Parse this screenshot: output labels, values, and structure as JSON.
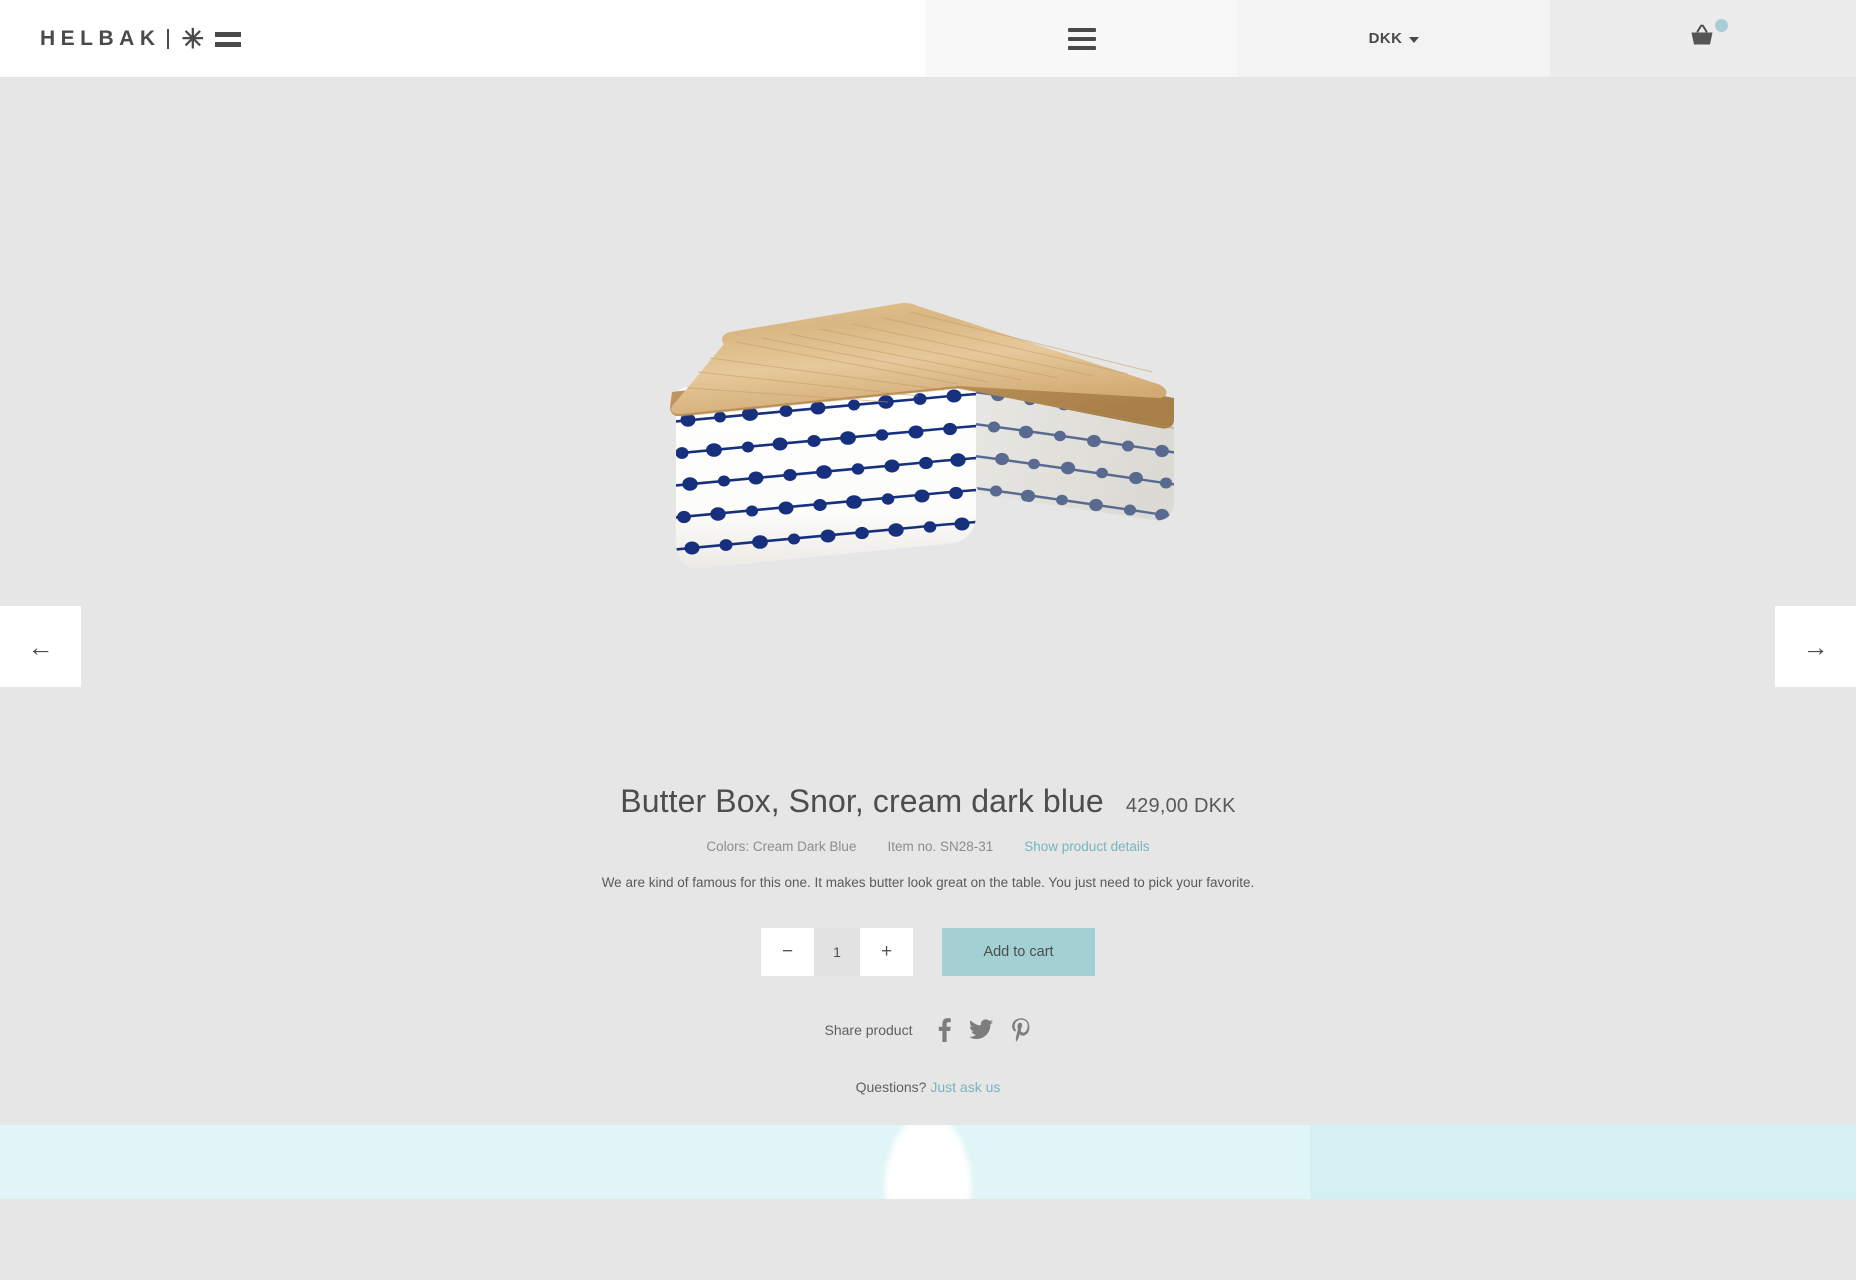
{
  "header": {
    "logo": {
      "word": "HELBAK",
      "asterisk": "✳",
      "divider_icon": "vertical-bar-icon",
      "equals_icon": "double-line-icon"
    },
    "menu_icon": "hamburger-menu-icon",
    "currency": {
      "selected": "DKK",
      "caret_icon": "chevron-down-icon"
    },
    "cart": {
      "icon": "shopping-basket-icon",
      "badge_color": "#a8cdd6"
    }
  },
  "gallery": {
    "prev_label": "←",
    "next_label": "→",
    "prev_icon": "arrow-left-icon",
    "next_icon": "arrow-right-icon",
    "product_image_alt": "Butter Box, Snor, cream dark blue - white ceramic box with navy blue beaded string pattern and oak wood lid"
  },
  "product": {
    "title": "Butter Box, Snor, cream dark blue",
    "price": "429,00 DKK",
    "colors": "Colors: Cream Dark Blue",
    "item_no": "Item no. SN28-31",
    "details_link": "Show product details",
    "description": "We are kind of famous for this one. It makes butter look great on the table. You just need to pick your favorite.",
    "quantity": "1",
    "decrease_label": "−",
    "increase_label": "+",
    "add_to_cart_label": "Add to cart",
    "add_to_cart_color": "#a3d0d2",
    "link_color": "#78b4bd"
  },
  "share": {
    "label": "Share product",
    "networks": [
      {
        "name": "facebook",
        "icon": "facebook-icon"
      },
      {
        "name": "twitter",
        "icon": "twitter-icon"
      },
      {
        "name": "pinterest",
        "icon": "pinterest-icon"
      }
    ]
  },
  "support": {
    "question_text": "Questions?",
    "link_text": "Just ask us"
  },
  "footer_banner": {
    "background_color": "#e0f5f7"
  }
}
